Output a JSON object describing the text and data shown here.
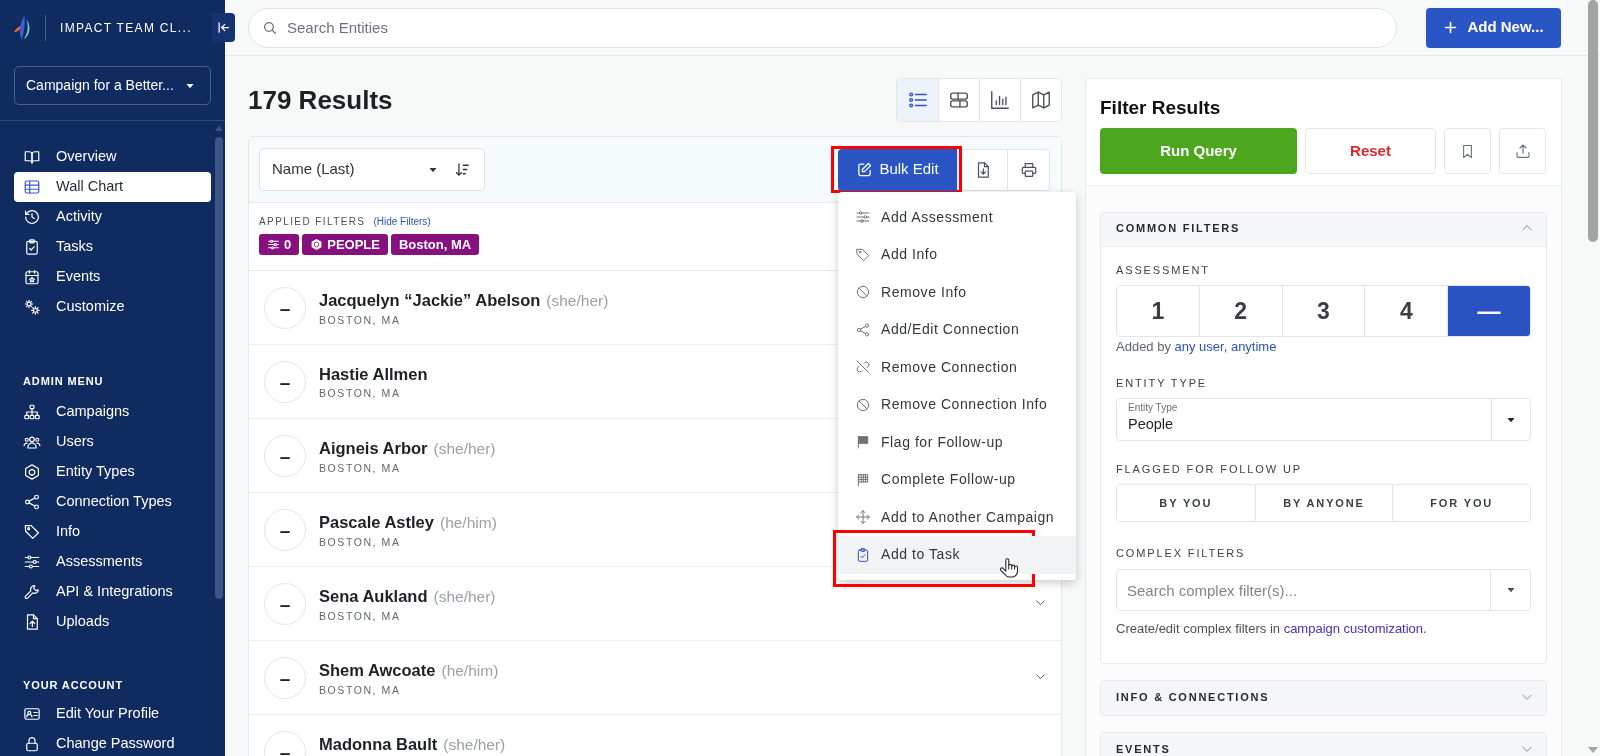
{
  "sidebar": {
    "brand": "IMPACT TEAM CL...",
    "campaign": "Campaign for a Better...",
    "groups": [
      {
        "items": [
          {
            "label": "Overview",
            "selected": false
          },
          {
            "label": "Wall Chart",
            "selected": true
          },
          {
            "label": "Activity",
            "selected": false
          },
          {
            "label": "Tasks",
            "selected": false
          },
          {
            "label": "Events",
            "selected": false
          },
          {
            "label": "Customize",
            "selected": false
          }
        ]
      },
      {
        "heading": "ADMIN MENU",
        "items": [
          {
            "label": "Campaigns",
            "selected": false
          },
          {
            "label": "Users",
            "selected": false
          },
          {
            "label": "Entity Types",
            "selected": false
          },
          {
            "label": "Connection Types",
            "selected": false
          },
          {
            "label": "Info",
            "selected": false
          },
          {
            "label": "Assessments",
            "selected": false
          },
          {
            "label": "API & Integrations",
            "selected": false
          },
          {
            "label": "Uploads",
            "selected": false
          }
        ]
      },
      {
        "heading": "YOUR ACCOUNT",
        "items": [
          {
            "label": "Edit Your Profile",
            "selected": false
          },
          {
            "label": "Change Password",
            "selected": false
          }
        ]
      }
    ]
  },
  "top_bar": {
    "search": {
      "placeholder": "Search Entities"
    },
    "add_button": "Add New..."
  },
  "results": {
    "title": "179 Results",
    "views": [
      {
        "selected": true
      },
      {
        "selected": false
      },
      {
        "selected": false
      },
      {
        "selected": false
      }
    ],
    "sort": {
      "value": "Name (Last)"
    },
    "bulk_edit": {
      "label": "Bulk Edit",
      "annotated": true
    },
    "applied_filters": {
      "label": "APPLIED FILTERS",
      "link": "(Hide Filters)",
      "chips": [
        {
          "label": "0"
        },
        {
          "label": "PEOPLE"
        },
        {
          "label": "Boston, MA"
        }
      ]
    },
    "rows": [
      {
        "assessment": "–",
        "name": "Jacquelyn “Jackie” Abelson",
        "pronouns": "(she/her)",
        "location": "BOSTON, MA",
        "chevron": false
      },
      {
        "assessment": "–",
        "name": "Hastie Allmen",
        "location": "BOSTON, MA",
        "chevron": false
      },
      {
        "assessment": "–",
        "name": "Aigneis Arbor",
        "pronouns": "(she/her)",
        "location": "BOSTON, MA",
        "chevron": false
      },
      {
        "assessment": "–",
        "name": "Pascale Astley",
        "pronouns": "(he/him)",
        "location": "BOSTON, MA",
        "chevron": false
      },
      {
        "assessment": "–",
        "name": "Sena Aukland",
        "pronouns": "(she/her)",
        "location": "BOSTON, MA",
        "chevron": true
      },
      {
        "assessment": "–",
        "name": "Shem Awcoate",
        "pronouns": "(he/him)",
        "location": "BOSTON, MA",
        "chevron": true
      },
      {
        "assessment": "–",
        "name": "Madonna Bault",
        "pronouns": "(she/her)",
        "chevron": false
      }
    ]
  },
  "bulk_menu": {
    "items": [
      {
        "label": "Add Assessment",
        "hovered": false,
        "annotated": false
      },
      {
        "label": "Add Info",
        "hovered": false,
        "annotated": false
      },
      {
        "label": "Remove Info",
        "hovered": false,
        "annotated": false
      },
      {
        "label": "Add/Edit Connection",
        "hovered": false,
        "annotated": false
      },
      {
        "label": "Remove Connection",
        "hovered": false,
        "annotated": false
      },
      {
        "label": "Remove Connection Info",
        "hovered": false,
        "annotated": false
      },
      {
        "label": "Flag for Follow-up",
        "hovered": false,
        "annotated": false
      },
      {
        "label": "Complete Follow-up",
        "hovered": false,
        "annotated": false
      },
      {
        "label": "Add to Another Campaign",
        "hovered": false,
        "annotated": false
      },
      {
        "label": "Add to Task",
        "hovered": true,
        "annotated": true
      }
    ]
  },
  "filter_panel": {
    "title": "Filter Results",
    "run_button": "Run Query",
    "reset_button": "Reset",
    "sections": [
      {
        "title": "COMMON FILTERS",
        "expanded": true,
        "assessment": {
          "label": "ASSESSMENT",
          "options": [
            {
              "label": "1",
              "selected": false
            },
            {
              "label": "2",
              "selected": false
            },
            {
              "label": "3",
              "selected": false
            },
            {
              "label": "4",
              "selected": false
            },
            {
              "label": "—",
              "selected": true
            }
          ],
          "note": "Added by",
          "note_link": "any user, anytime"
        },
        "entity_type": {
          "label": "ENTITY TYPE",
          "field_label": "Entity Type",
          "value": "People"
        },
        "follow_up": {
          "label": "FLAGGED FOR FOLLOW UP",
          "options": [
            {
              "label": "BY YOU",
              "selected": false
            },
            {
              "label": "BY ANYONE",
              "selected": false
            },
            {
              "label": "FOR YOU",
              "selected": false
            }
          ]
        },
        "complex_filters": {
          "label": "COMPLEX FILTERS",
          "placeholder": "Search complex filter(s)...",
          "help": "Create/edit complex filters in",
          "help_link": "campaign customization",
          "help_end": "."
        }
      },
      {
        "title": "INFO & CONNECTIONS",
        "expanded": false
      },
      {
        "title": "EVENTS",
        "expanded": false
      }
    ]
  }
}
